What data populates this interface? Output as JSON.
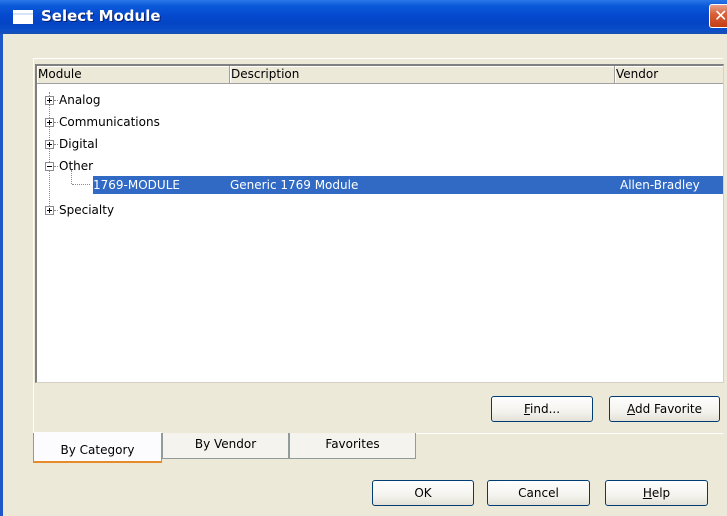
{
  "window": {
    "title": "Select Module",
    "close_glyph": "✕"
  },
  "list": {
    "columns": {
      "module": "Module",
      "description": "Description",
      "vendor": "Vendor"
    },
    "categories": [
      {
        "label": "Analog",
        "expanded": false
      },
      {
        "label": "Communications",
        "expanded": false
      },
      {
        "label": "Digital",
        "expanded": false
      },
      {
        "label": "Other",
        "expanded": true
      },
      {
        "label": "Specialty",
        "expanded": false
      }
    ],
    "selected_item": {
      "module": "1769-MODULE",
      "description": "Generic 1769 Module",
      "vendor": "Allen-Bradley"
    }
  },
  "buttons": {
    "find": {
      "label_underlined": "F",
      "label_rest": "ind..."
    },
    "add_favorite": {
      "label_underlined": "A",
      "label_rest": "dd Favorite"
    },
    "ok": "OK",
    "cancel": "Cancel",
    "help": {
      "label_underlined": "H",
      "label_rest": "elp"
    }
  },
  "tabs": {
    "by_category": "By Category",
    "by_vendor": "By Vendor",
    "favorites": "Favorites",
    "active": "by_category"
  },
  "colors": {
    "selection": "#316ac5",
    "titlebar": "#0549cf",
    "dialog_bg": "#ece9d8",
    "tab_accent": "#e68b2c"
  },
  "icons": {
    "window_icon": "window-icon",
    "close": "close-icon",
    "expand": "plus-box-icon",
    "collapse": "minus-box-icon"
  }
}
